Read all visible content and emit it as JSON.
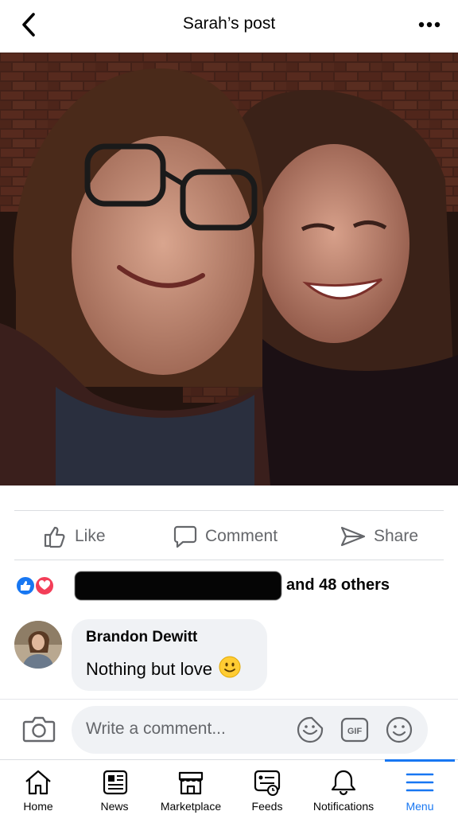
{
  "header": {
    "title": "Sarah’s post"
  },
  "post": {
    "actions": [
      {
        "label": "Like",
        "icon": "thumbs-up-icon"
      },
      {
        "label": "Comment",
        "icon": "speech-bubble-icon"
      },
      {
        "label": "Share",
        "icon": "share-arrow-icon"
      }
    ],
    "reactions_text": "and 48 others"
  },
  "comment": {
    "author": "Brandon Dewitt",
    "text": "Nothing but love",
    "emoji": "slightly-smiling-face-icon"
  },
  "composer": {
    "placeholder": "Write a comment..."
  },
  "tabbar": {
    "tabs": [
      {
        "label": "Home",
        "icon": "home-icon"
      },
      {
        "label": "News",
        "icon": "newspaper-icon"
      },
      {
        "label": "Marketplace",
        "icon": "storefront-icon"
      },
      {
        "label": "Feeds",
        "icon": "feeds-icon"
      },
      {
        "label": "Notifications",
        "icon": "bell-icon"
      },
      {
        "label": "Menu",
        "icon": "menu-icon",
        "active": true
      }
    ]
  },
  "colors": {
    "accent": "#1877f2",
    "secondary_text": "#65676b",
    "bubble": "#f0f2f5",
    "love": "#f33e58"
  }
}
